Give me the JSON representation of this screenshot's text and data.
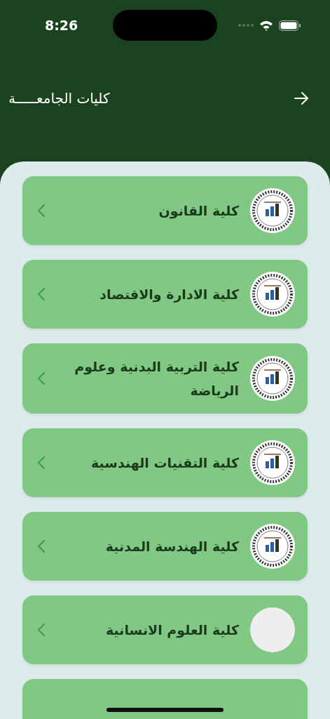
{
  "status_bar": {
    "time": "8:26"
  },
  "header": {
    "title": "كليات الجامعـــــة"
  },
  "colleges": [
    {
      "kind": "emblem",
      "name": "كلية القانون"
    },
    {
      "kind": "emblem",
      "name": "كلية الادارة والاقتصاد"
    },
    {
      "kind": "emblem",
      "name": "كلية التربية البدنية وعلوم الرياضة"
    },
    {
      "kind": "emblem",
      "name": "كلية التقنيات الهندسية"
    },
    {
      "kind": "emblem",
      "name": "كلية الهندسة المدنية"
    },
    {
      "kind": "blank",
      "name": "كلية العلوم الانسانية"
    },
    {
      "kind": "cut"
    }
  ]
}
